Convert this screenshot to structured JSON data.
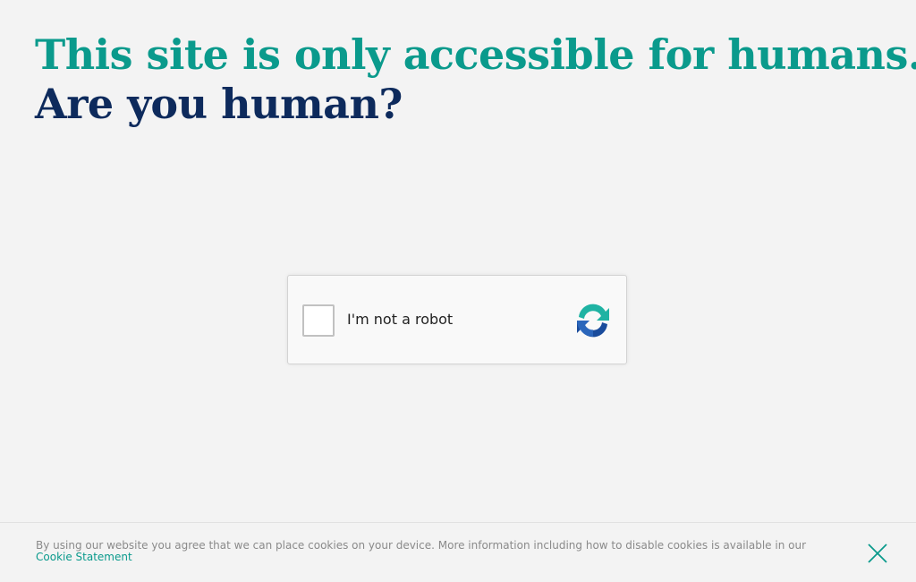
{
  "headline": {
    "line1": "This site is only accessible for humans.",
    "line2": "Are you human?"
  },
  "captcha": {
    "checkbox_label": "I'm not a robot",
    "checked": false,
    "logo_icon": "recaptcha-logo-icon",
    "colors": {
      "logo_teal": "#1fb3a3",
      "logo_blue": "#1a4c9c"
    }
  },
  "cookie_bar": {
    "message": "By using our website you agree that we can place cookies on your device. More information including how to disable cookies is available in our",
    "link_label": "Cookie Statement",
    "close_icon": "close-icon"
  },
  "colors": {
    "background": "#f3f3f3",
    "headline_teal": "#0a9a8c",
    "headline_navy": "#0d2a5c",
    "link": "#0a9a8c",
    "muted_text": "#8a8a8a"
  }
}
